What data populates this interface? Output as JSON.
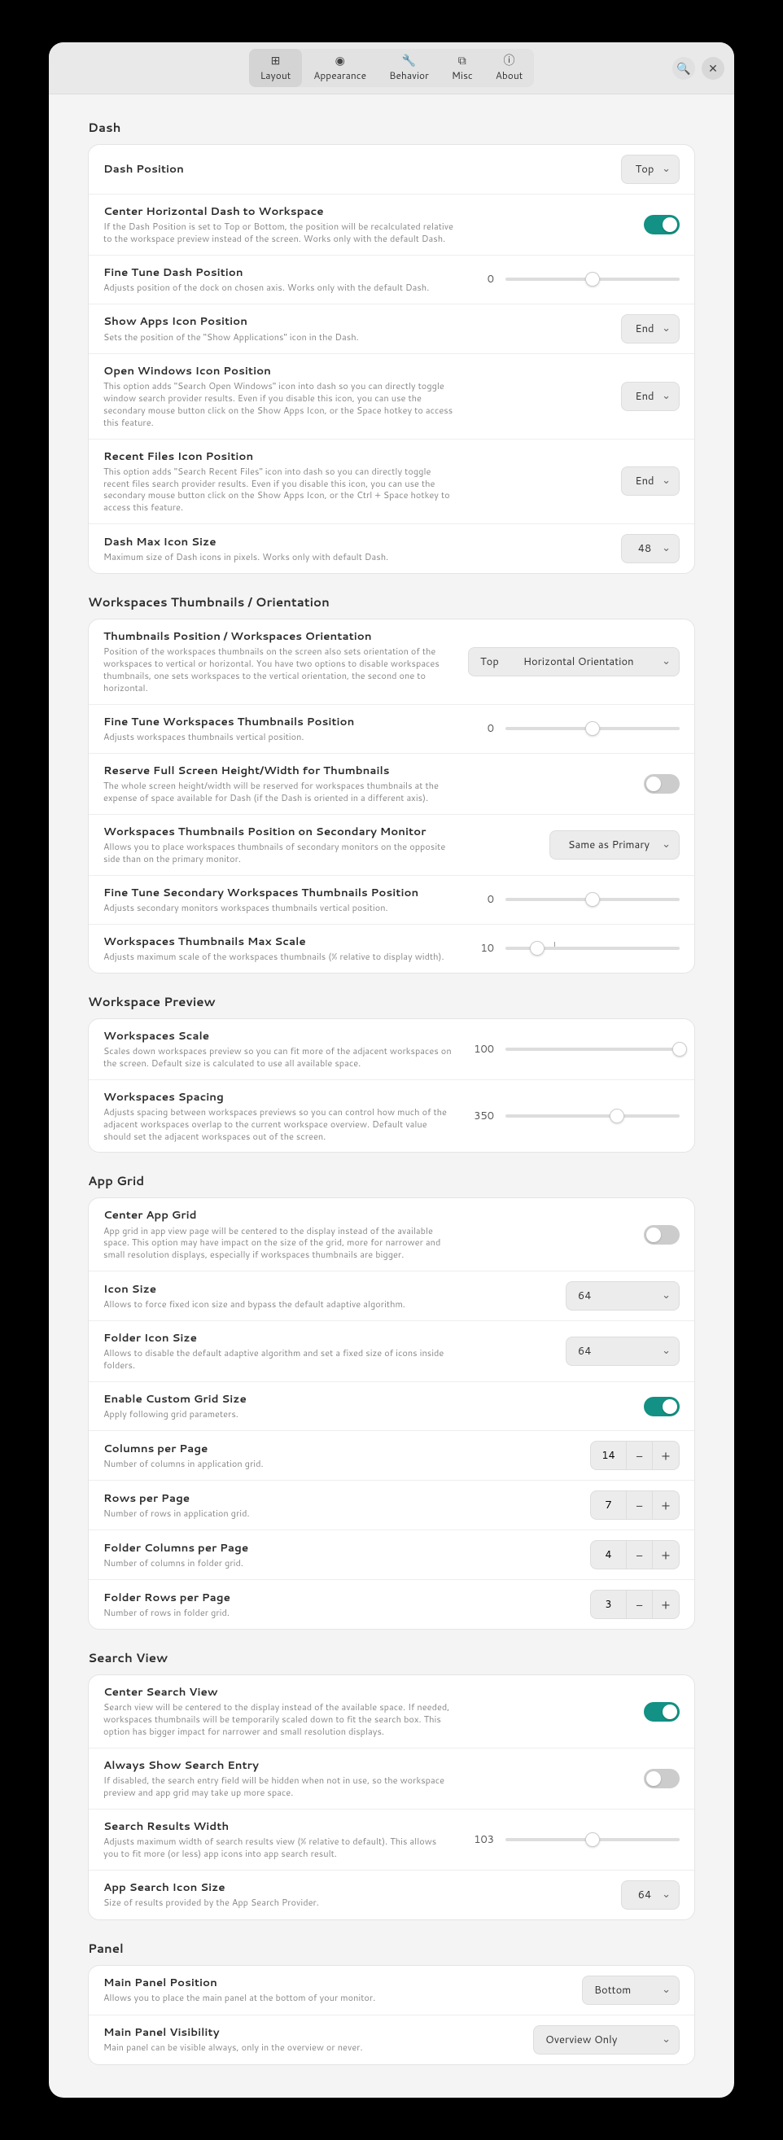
{
  "tabs": [
    {
      "label": "Layout",
      "icon": "⊞"
    },
    {
      "label": "Appearance",
      "icon": "👁"
    },
    {
      "label": "Behavior",
      "icon": "🔧"
    },
    {
      "label": "Misc",
      "icon": "⧉"
    },
    {
      "label": "About",
      "icon": "ⓘ"
    }
  ],
  "sections": {
    "dash": {
      "title": "Dash",
      "items": {
        "pos": {
          "title": "Dash Position",
          "value": "Top"
        },
        "center": {
          "title": "Center Horizontal Dash to Workspace",
          "desc": "If the Dash Position is set to Top or Bottom, the position will be recalculated relative to the workspace preview instead of the screen. Works only with the default Dash.",
          "on": true
        },
        "finetune": {
          "title": "Fine Tune Dash Position",
          "desc": "Adjusts position of the dock on chosen axis. Works only with the default Dash.",
          "value": 0,
          "pos": 50
        },
        "apps": {
          "title": "Show Apps Icon Position",
          "desc": "Sets the position of the \"Show Applications\" icon in the Dash.",
          "value": "End"
        },
        "openwin": {
          "title": "Open Windows Icon Position",
          "desc": "This option adds \"Search Open Windows\" icon into dash so you can directly toggle window search provider results. Even if you disable this icon, you can use the secondary mouse button click on the Show Apps Icon, or the Space hotkey to access this feature.",
          "value": "End"
        },
        "recent": {
          "title": "Recent Files Icon Position",
          "desc": "This option adds \"Search Recent Files\" icon into dash so you can directly toggle recent files search provider results. Even if you disable this icon, you can use the secondary mouse button click on the Show Apps Icon, or the Ctrl + Space hotkey to access this feature.",
          "value": "End"
        },
        "maxicon": {
          "title": "Dash Max Icon Size",
          "desc": "Maximum size of Dash icons in pixels. Works only with default Dash.",
          "value": "48"
        }
      }
    },
    "wsThumbs": {
      "title": "Workspaces Thumbnails / Orientation",
      "items": {
        "pos": {
          "title": "Thumbnails Position / Workspaces Orientation",
          "desc": "Position of the workspaces thumbnails on the screen also sets orientation of the workspaces to vertical or horizontal. You have two options to disable workspaces thumbnails, one sets workspaces to the vertical orientation, the second one to horizontal.",
          "v1": "Top",
          "v2": "Horizontal Orientation"
        },
        "finetune": {
          "title": "Fine Tune Workspaces Thumbnails Position",
          "desc": "Adjusts workspaces thumbnails vertical position.",
          "value": 0,
          "pos": 50
        },
        "reserve": {
          "title": "Reserve Full Screen Height/Width for Thumbnails",
          "desc": "The whole screen height/width will be reserved for workspaces thumbnails at the expense of space available for Dash (if the Dash is oriented in a different axis).",
          "on": false
        },
        "secondary": {
          "title": "Workspaces Thumbnails Position on Secondary Monitor",
          "desc": "Allows you to place workspaces thumbnails of secondary monitors on the opposite side than on the primary monitor.",
          "value": "Same as Primary"
        },
        "finetune2": {
          "title": "Fine Tune Secondary Workspaces Thumbnails Position",
          "desc": "Adjusts secondary monitors workspaces thumbnails vertical position.",
          "value": 0,
          "pos": 50
        },
        "maxscale": {
          "title": "Workspaces Thumbnails Max Scale",
          "desc": "Adjusts maximum scale of the workspaces thumbnails (% relative to display width).",
          "value": 10,
          "pos": 18,
          "mark": 28
        }
      }
    },
    "wsPreview": {
      "title": "Workspace Preview",
      "items": {
        "scale": {
          "title": "Workspaces Scale",
          "desc": "Scales down workspaces preview so you can fit more of the adjacent workspaces on the screen. Default size is calculated to use all available space.",
          "value": 100,
          "pos": 100
        },
        "spacing": {
          "title": "Workspaces Spacing",
          "desc": "Adjusts spacing between workspaces previews so you can control how much of the adjacent workspaces overlap to the current workspace overview. Default value should set the adjacent workspaces out of the screen.",
          "value": 350,
          "pos": 64
        }
      }
    },
    "appGrid": {
      "title": "App Grid",
      "items": {
        "center": {
          "title": "Center App Grid",
          "desc": "App grid in app view page will be centered to the display instead of the available space. This option may have impact on the size of the grid, more for narrower and small resolution displays, especially if workspaces thumbnails are bigger.",
          "on": false
        },
        "iconsize": {
          "title": "Icon Size",
          "desc": "Allows to force fixed icon size and bypass the default adaptive algorithm.",
          "value": "64"
        },
        "foldericon": {
          "title": "Folder Icon Size",
          "desc": "Allows to disable the default adaptive algorithm and set a fixed size of icons inside folders.",
          "value": "64"
        },
        "custom": {
          "title": "Enable Custom Grid Size",
          "desc": "Apply following grid parameters.",
          "on": true
        },
        "cols": {
          "title": "Columns per Page",
          "desc": "Number of columns in application grid.",
          "value": 14
        },
        "rows": {
          "title": "Rows per Page",
          "desc": "Number of rows in application grid.",
          "value": 7
        },
        "fcols": {
          "title": "Folder Columns per Page",
          "desc": "Number of columns in folder grid.",
          "value": 4
        },
        "frows": {
          "title": "Folder Rows per Page",
          "desc": "Number of rows in folder grid.",
          "value": 3
        }
      }
    },
    "search": {
      "title": "Search View",
      "items": {
        "center": {
          "title": "Center Search View",
          "desc": "Search view will be centered to the display instead of the available space. If needed, workspaces thumbnails will be temporarily scaled down to fit the search box. This option has bigger impact for narrower and small resolution displays.",
          "on": true
        },
        "always": {
          "title": "Always Show Search Entry",
          "desc": "If disabled, the search entry field will be hidden when not in use, so the workspace preview and app grid may take up more space.",
          "on": false
        },
        "width": {
          "title": "Search Results Width",
          "desc": "Adjusts maximum width of search results view (% relative to default). This allows you to fit more (or less) app icons into app search result.",
          "value": 103,
          "pos": 50
        },
        "iconsize": {
          "title": "App Search Icon Size",
          "desc": "Size of results provided by the App Search Provider.",
          "value": "64"
        }
      }
    },
    "panel": {
      "title": "Panel",
      "items": {
        "pos": {
          "title": "Main Panel Position",
          "desc": "Allows you to place the main panel at the bottom of your monitor.",
          "value": "Bottom"
        },
        "vis": {
          "title": "Main Panel Visibility",
          "desc": "Main panel can be visible always, only in the overview or never.",
          "value": "Overview Only"
        }
      }
    }
  }
}
